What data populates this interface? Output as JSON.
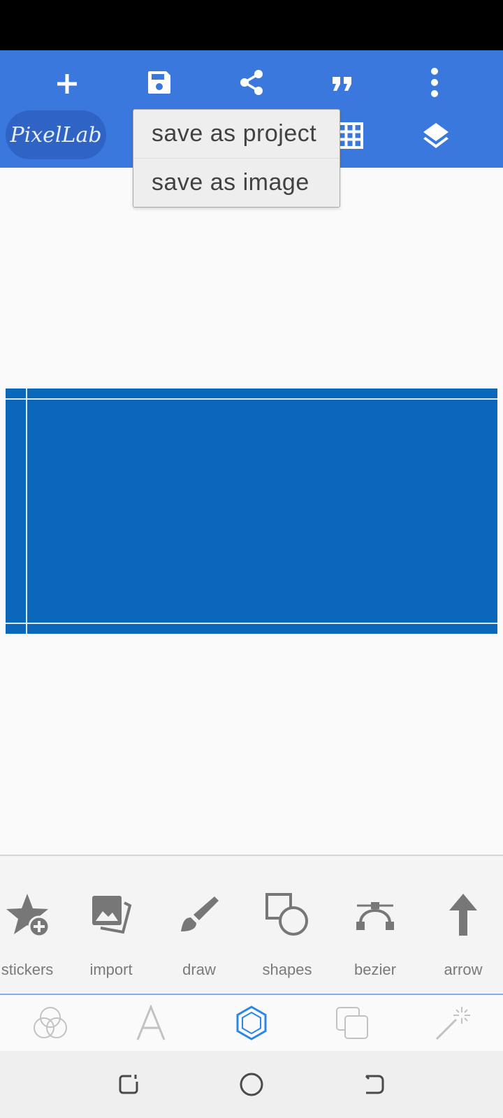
{
  "app": {
    "logo_text": "PixelLab"
  },
  "toolbar": {
    "add_icon": "plus-icon",
    "save_icon": "floppy-save-icon",
    "share_icon": "share-icon",
    "quote_icon": "quote-icon",
    "more_icon": "more-vertical-icon",
    "grid_icon": "grid-icon",
    "layers_icon": "layers-icon"
  },
  "save_menu": {
    "items": [
      {
        "label": "save as project"
      },
      {
        "label": "save as image"
      }
    ]
  },
  "tools": [
    {
      "label": "stickers",
      "icon": "star-add-icon"
    },
    {
      "label": "import",
      "icon": "image-import-icon"
    },
    {
      "label": "draw",
      "icon": "brush-icon"
    },
    {
      "label": "shapes",
      "icon": "shapes-icon"
    },
    {
      "label": "bezier",
      "icon": "bezier-icon"
    },
    {
      "label": "arrow",
      "icon": "arrow-up-icon"
    }
  ],
  "tabs": [
    {
      "name": "tab-color",
      "icon": "color-circles-icon",
      "active": false
    },
    {
      "name": "tab-text",
      "icon": "text-a-icon",
      "active": false
    },
    {
      "name": "tab-shapes",
      "icon": "hexagon-icon",
      "active": true
    },
    {
      "name": "tab-layers",
      "icon": "stack-icon",
      "active": false
    },
    {
      "name": "tab-effects",
      "icon": "magic-wand-icon",
      "active": false
    }
  ],
  "colors": {
    "app_bar": "#3a78de",
    "design_fill": "#0b67ba",
    "active_tab": "#2a86e8"
  }
}
